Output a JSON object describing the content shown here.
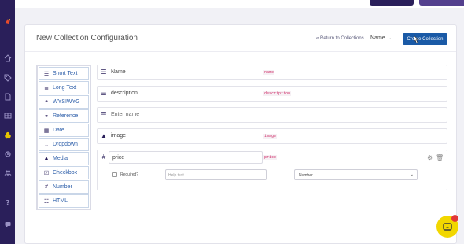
{
  "header": {
    "title": "New Collection Configuration",
    "return_link": "« Return to Collections",
    "sort_select": "Name",
    "create_button": "Create Collection"
  },
  "field_types": [
    {
      "label": "Short Text",
      "icon": "short-text-icon"
    },
    {
      "label": "Long Text",
      "icon": "long-text-icon"
    },
    {
      "label": "WYSIWYG",
      "icon": "quote-icon"
    },
    {
      "label": "Reference",
      "icon": "link-icon"
    },
    {
      "label": "Date",
      "icon": "calendar-icon"
    },
    {
      "label": "Dropdown",
      "icon": "chevron-down-icon"
    },
    {
      "label": "Media",
      "icon": "image-icon"
    },
    {
      "label": "Checkbox",
      "icon": "checkbox-icon"
    },
    {
      "label": "Number",
      "icon": "hash-icon"
    },
    {
      "label": "HTML",
      "icon": "list-icon"
    }
  ],
  "fields": [
    {
      "name": "Name",
      "key": "name",
      "icon": "short-text-icon"
    },
    {
      "name": "description",
      "key": "description",
      "icon": "short-text-icon"
    },
    {
      "name": "Enter name",
      "key": "",
      "icon": "short-text-icon"
    },
    {
      "name": "image",
      "key": "image",
      "icon": "image-icon"
    }
  ],
  "expanded_field": {
    "name": "price",
    "key": "price",
    "required_label": "Required?",
    "help_placeholder": "Help text",
    "type_value": "Number"
  },
  "colors": {
    "nav": "#2a1f5a",
    "accent": "#1a5aa6",
    "key_pink": "#d0306a",
    "chat": "#f2d700"
  }
}
